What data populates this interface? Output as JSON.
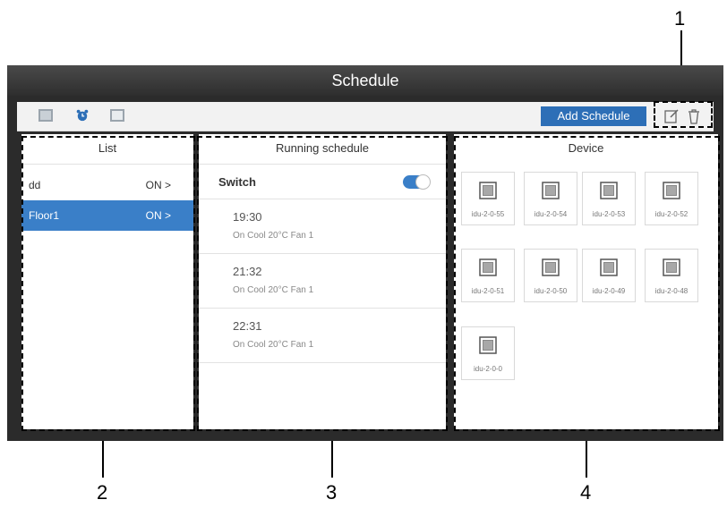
{
  "window": {
    "title": "Schedule"
  },
  "toolbar": {
    "icons": [
      "calendar-icon",
      "alarm-clock-icon",
      "list-view-icon"
    ],
    "add_schedule_label": "Add Schedule",
    "edit_icon": "edit-icon",
    "delete_icon": "trash-icon"
  },
  "list_panel": {
    "header": "List",
    "items": [
      {
        "name": "dd",
        "state": "ON >",
        "selected": false
      },
      {
        "name": "Floor1",
        "state": "ON >",
        "selected": true
      }
    ]
  },
  "running_panel": {
    "header": "Running schedule",
    "switch_label": "Switch",
    "switch_on": true,
    "entries": [
      {
        "time": "19:30",
        "detail": "On Cool 20°C Fan 1"
      },
      {
        "time": "21:32",
        "detail": "On Cool 20°C Fan 1"
      },
      {
        "time": "22:31",
        "detail": "On Cool 20°C Fan 1"
      }
    ]
  },
  "device_panel": {
    "header": "Device",
    "devices": [
      "idu-2-0-55",
      "idu-2-0-54",
      "idu-2-0-53",
      "idu-2-0-52",
      "idu-2-0-51",
      "idu-2-0-50",
      "idu-2-0-49",
      "idu-2-0-48",
      "idu-2-0-0"
    ]
  },
  "callouts": [
    "1",
    "2",
    "3",
    "4"
  ],
  "colors": {
    "accent": "#2d6fb7",
    "selected_row": "#3a7fc8",
    "window_dark": "#2b2b2b"
  }
}
